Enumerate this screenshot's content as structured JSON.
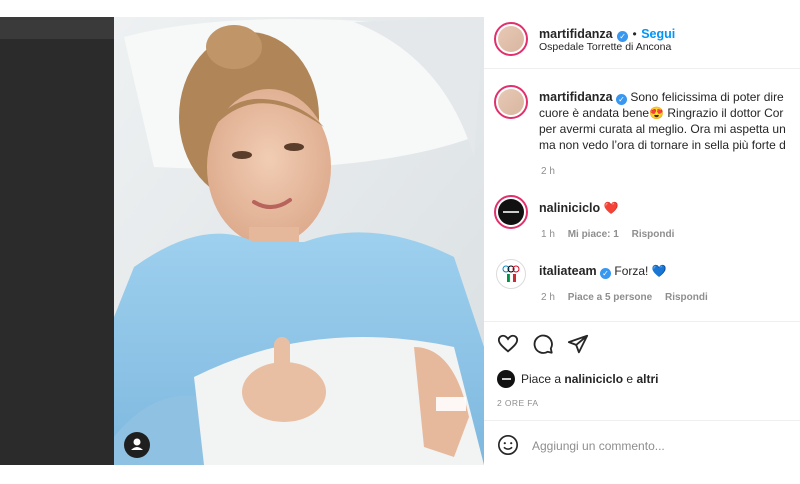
{
  "post": {
    "author": "martifidanza",
    "follow_label": "Segui",
    "separator": "•",
    "location": "Ospedale Torrette di Ancona"
  },
  "caption": {
    "author": "martifidanza",
    "line1": "Sono felicissima di poter dire",
    "line2": "cuore è andata bene😍 Ringrazio il dottor Cor",
    "line3": "per avermi curata al meglio. Ora mi aspetta un",
    "line4": "ma non vedo l’ora di tornare in sella più forte d",
    "time": "2 h"
  },
  "comments": [
    {
      "user": "naliniciclo",
      "text": "❤️",
      "time": "1 h",
      "likes": "Mi piace: 1",
      "reply": "Rispondi"
    },
    {
      "user": "italiateam",
      "text": "Forza! 💙",
      "time": "2 h",
      "likes": "Piace a 5 persone",
      "reply": "Rispondi"
    }
  ],
  "actions": {
    "like_icon": "heart-icon",
    "comment_icon": "comment-icon",
    "share_icon": "share-icon"
  },
  "likes": {
    "prefix": "Piace a",
    "user": "naliniciclo",
    "middle": "e",
    "others": "altri"
  },
  "timestamp": "2 ORE FA",
  "add_comment": {
    "placeholder": "Aggiungi un commento...",
    "emoji_icon": "emoji-icon"
  },
  "colors": {
    "follow_blue": "#0095f6",
    "verified_blue": "#3897f0",
    "heart_red": "#ed4956"
  }
}
